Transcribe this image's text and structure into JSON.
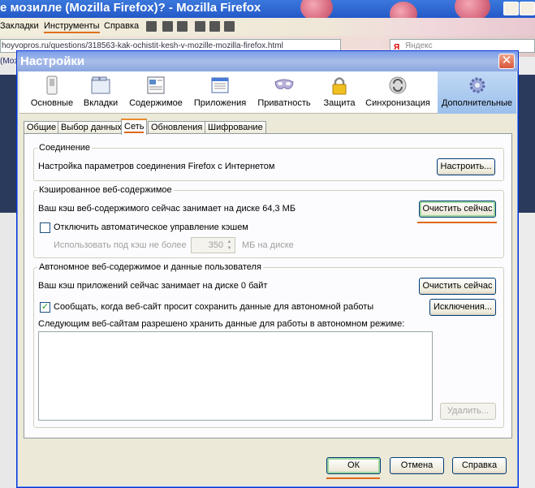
{
  "background_window": {
    "title": "е мозилле (Mozilla Firefox)? - Mozilla Firefox",
    "menu": [
      "Закладки",
      "Инструменты",
      "Справка"
    ],
    "url": "hoyvopros.ru/questions/318563-kak-ochistit-kesh-v-mozille-mozilla-firefox.html",
    "search_placeholder": "Яндекс",
    "search_logo": "Я",
    "tab_label": "(Моз"
  },
  "dialog": {
    "title": "Настройки",
    "close_glyph": "✕",
    "toolbar": [
      {
        "label": "Основные",
        "icon": "switch-icon"
      },
      {
        "label": "Вкладки",
        "icon": "tabs-icon"
      },
      {
        "label": "Содержимое",
        "icon": "content-icon"
      },
      {
        "label": "Приложения",
        "icon": "applications-icon"
      },
      {
        "label": "Приватность",
        "icon": "mask-icon"
      },
      {
        "label": "Защита",
        "icon": "lock-icon"
      },
      {
        "label": "Синхронизация",
        "icon": "sync-icon"
      },
      {
        "label": "Дополнительные",
        "icon": "gear-icon"
      }
    ],
    "tabs": [
      "Общие",
      "Выбор данных",
      "Сеть",
      "Обновления",
      "Шифрование"
    ],
    "connection": {
      "legend": "Соединение",
      "text": "Настройка параметров соединения Firefox с Интернетом",
      "button": "Настроить..."
    },
    "cache": {
      "legend": "Кэшированное веб-содержимое",
      "text": "Ваш кэш веб-содержимого сейчас занимает на диске 64,3 МБ",
      "clear_button": "Очистить сейчас",
      "override_checkbox": "Отключить автоматическое управление кэшем",
      "override_checked": false,
      "limit_label": "Использовать под кэш не более",
      "limit_value": "350",
      "limit_unit": "МБ на диске"
    },
    "offline": {
      "legend": "Автономное веб-содержимое и данные пользователя",
      "text": "Ваш кэш приложений сейчас занимает на диске 0 байт",
      "clear_button": "Очистить сейчас",
      "notify_checkbox": "Сообщать, когда веб-сайт просит сохранить данные для автономной работы",
      "notify_checked": true,
      "exceptions_button": "Исключения...",
      "list_label": "Следующим веб-сайтам разрешено хранить данные для работы в автономном режиме:",
      "remove_button": "Удалить..."
    },
    "footer": {
      "ok": "ОК",
      "cancel": "Отмена",
      "help": "Справка"
    }
  },
  "colors": {
    "accent_underline": "#e06a1a",
    "selected_toolbar": "#9cc0ec",
    "titlebar": "#8aa6e0"
  }
}
